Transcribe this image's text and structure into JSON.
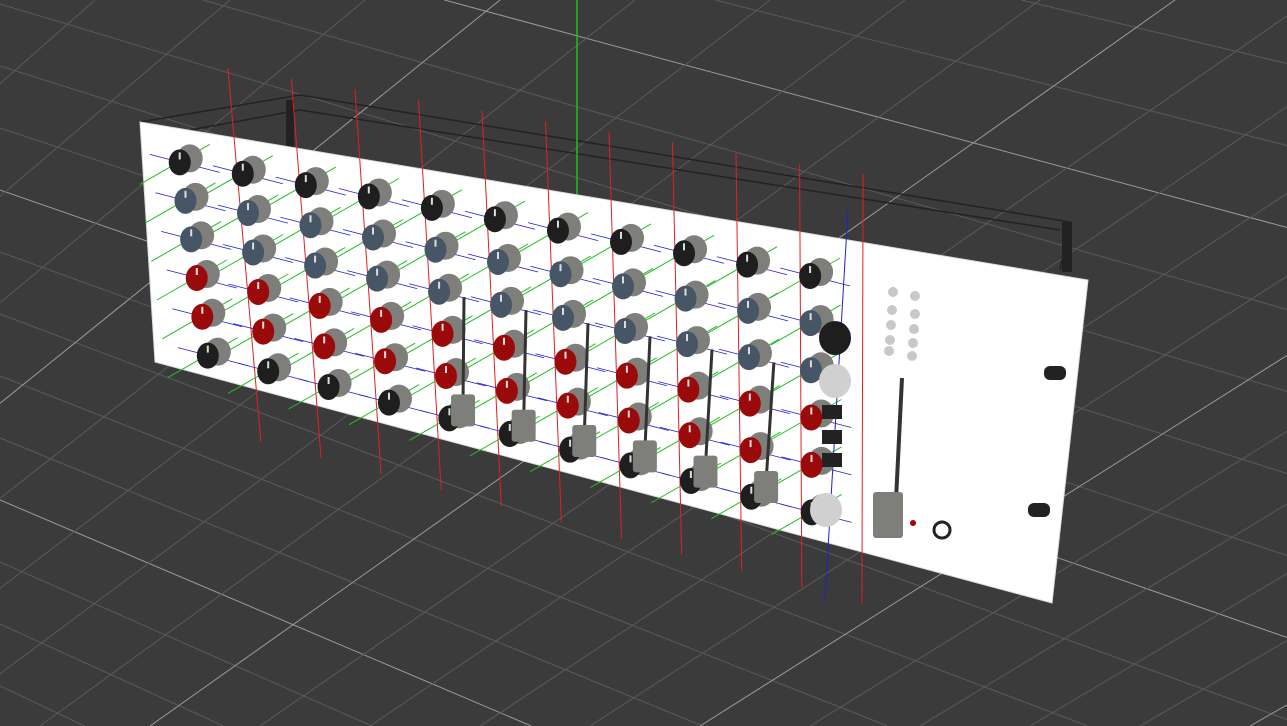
{
  "viewport": {
    "background_color": "#3b3b3b",
    "grid_color": "#5a5a5a",
    "grid_major_color": "#9a9a9a",
    "axis_colors": {
      "x": "#e02020",
      "y": "#20c020",
      "z": "#2020d0"
    }
  },
  "model": {
    "panel_color": "#ffffff",
    "knob_colors": {
      "cap_gray": "#7e7f7a",
      "red": "#9a0a0a",
      "blue": "#465666",
      "black": "#1e1e1e",
      "light": "#d0d0d0"
    }
  }
}
